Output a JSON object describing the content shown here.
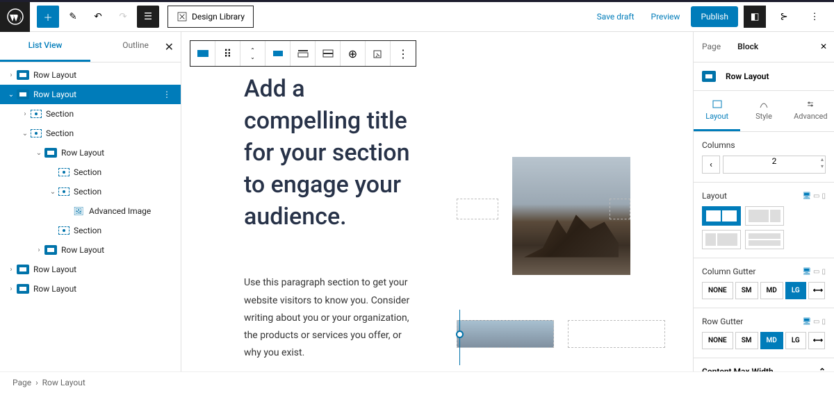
{
  "topbar": {
    "design_library": "Design Library",
    "save_draft": "Save draft",
    "preview": "Preview",
    "publish": "Publish"
  },
  "left_panel": {
    "tabs": {
      "list_view": "List View",
      "outline": "Outline"
    },
    "tree": [
      {
        "label": "Row Layout",
        "type": "row",
        "depth": 0,
        "chev": ">"
      },
      {
        "label": "Row Layout",
        "type": "row",
        "depth": 0,
        "chev": "v",
        "selected": true
      },
      {
        "label": "Section",
        "type": "sec",
        "depth": 1,
        "chev": ">"
      },
      {
        "label": "Section",
        "type": "sec",
        "depth": 1,
        "chev": "v"
      },
      {
        "label": "Row Layout",
        "type": "row",
        "depth": 2,
        "chev": "v"
      },
      {
        "label": "Section",
        "type": "sec",
        "depth": 3,
        "chev": ""
      },
      {
        "label": "Section",
        "type": "sec",
        "depth": 3,
        "chev": "v"
      },
      {
        "label": "Advanced Image",
        "type": "img",
        "depth": 4,
        "chev": ""
      },
      {
        "label": "Section",
        "type": "sec",
        "depth": 3,
        "chev": ""
      },
      {
        "label": "Row Layout",
        "type": "row",
        "depth": 2,
        "chev": ">"
      },
      {
        "label": "Row Layout",
        "type": "row",
        "depth": 0,
        "chev": ">"
      },
      {
        "label": "Row Layout",
        "type": "row",
        "depth": 0,
        "chev": ">"
      }
    ]
  },
  "canvas": {
    "title": "Add a compelling title for your section to engage your audience.",
    "paragraph": "Use this paragraph section to get your website visitors to know you. Consider writing about you or your organization, the products or services you offer, or why you exist."
  },
  "right_panel": {
    "tabs": {
      "page": "Page",
      "block": "Block"
    },
    "block_name": "Row Layout",
    "subtabs": {
      "layout": "Layout",
      "style": "Style",
      "advanced": "Advanced"
    },
    "columns": {
      "label": "Columns",
      "value": "2"
    },
    "layout_label": "Layout",
    "column_gutter": {
      "label": "Column Gutter",
      "options": [
        "NONE",
        "SM",
        "MD",
        "LG"
      ],
      "active": "LG"
    },
    "row_gutter": {
      "label": "Row Gutter",
      "options": [
        "NONE",
        "SM",
        "MD",
        "LG"
      ],
      "active": "MD"
    },
    "content_max_width": "Content Max Width"
  },
  "breadcrumb": {
    "page": "Page",
    "current": "Row Layout"
  }
}
